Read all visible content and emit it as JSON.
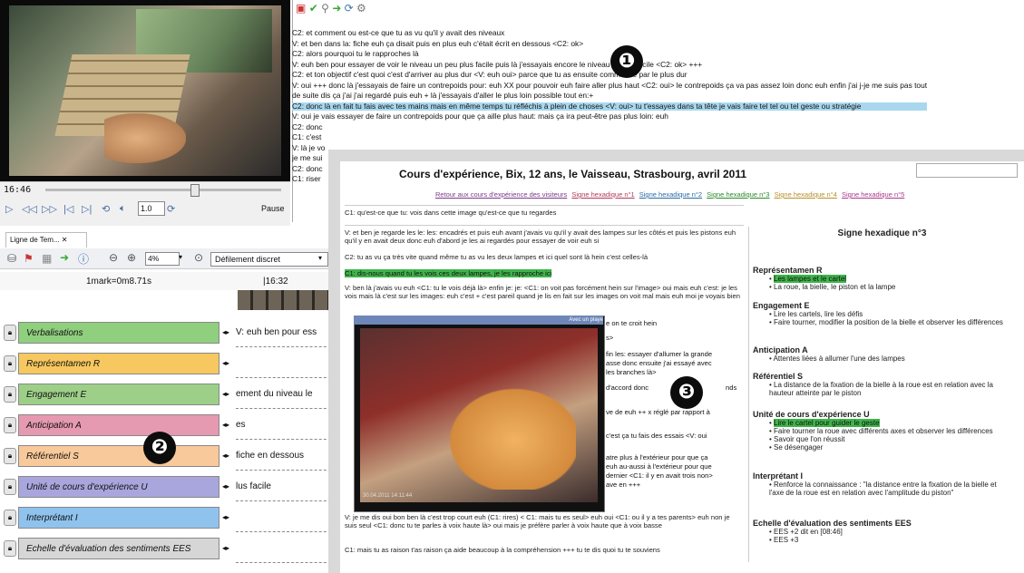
{
  "player": {
    "timecode": "16:46",
    "speed": "1.0",
    "pause_label": "Pause"
  },
  "transcript": {
    "lines": [
      "C2: et comment ou est-ce que tu as vu qu'il y avait des niveaux",
      "V: et ben dans la: fiche euh ça disait puis en plus euh c'était écrit en dessous <C2: ok>",
      "C2: alors pourquoi tu le rapproches là",
      "V: euh ben pour essayer de voir le niveau un peu plus facile puis là j'essayais encore le niveau le plus facile <C2: ok> +++",
      "C2: et ton objectif c'est quoi c'est d'arriver au plus dur <V: euh oui> parce que tu as ensuite commencé par le plus dur",
      "V: oui +++ donc là j'essayais de faire un contrepoids pour: euh XX pour pouvoir euh faire aller plus haut <C2: oui> le contrepoids ça va pas assez loin donc euh enfin j'ai j-je me suis pas tout",
      "de suite dis ça j'ai j'ai regardé puis euh + là j'essayais d'aller le plus loin possible tout en:+",
      "C2: donc là en fait tu fais avec tes mains mais en même temps tu réfléchis à plein de choses <V: oui> tu t'essayes dans ta tête je vais faire tel tel ou tel geste ou stratégie",
      "V: oui je vais essayer de faire un contrepoids pour que ça aille plus haut: mais ça ira peut-être pas plus loin: euh",
      "C2: donc",
      "C1: c'est",
      "V: là je vo",
      "je me sui",
      "C2: donc",
      "C1: riser"
    ]
  },
  "timeline": {
    "tab_label": "Ligne de Tem... ✕",
    "zoom": "4%",
    "scroll_mode": "Défilement discret",
    "mark_scale": "1mark=0m8.71s",
    "time_marker": "|16:32",
    "tracks": [
      {
        "label": "Verbalisations",
        "color": "#8fcf7e",
        "text": "V: euh ben pour ess"
      },
      {
        "label": "Représentamen R",
        "color": "#f6c85f",
        "text": ""
      },
      {
        "label": "Engagement E",
        "color": "#9dcf88",
        "text": "ement du niveau le"
      },
      {
        "label": "Anticipation A",
        "color": "#e59ab2",
        "text": "es"
      },
      {
        "label": "Référentiel S",
        "color": "#f8c99a",
        "text": "fiche en dessous"
      },
      {
        "label": "Unité de cours d'expérience U",
        "color": "#a9a6dd",
        "text": "lus facile"
      },
      {
        "label": "Interprétant I",
        "color": "#8fc3ee",
        "text": ""
      },
      {
        "label": "Echelle d'évaluation des sentiments EES",
        "color": "#d6d6d6",
        "text": ""
      }
    ]
  },
  "doc": {
    "title": "Cours d'expérience, Bix, 12 ans, le Vaisseau, Strasbourg, avril 2011",
    "links": [
      "Retour aux cours d'expérience des visiteurs",
      "Signe hexadique n°1",
      "Signe hexadique n°2",
      "Signe hexadique n°3",
      "Signe hexadique n°4",
      "Signe hexadique n°5"
    ],
    "q1": "C1: qu'est-ce que tu: vois dans cette image qu'est-ce que tu regardes",
    "p1": "V: et ben je regarde les le: les: encadrés et puis euh avant j'avais vu qu'il y avait des lampes sur les côtés et puis les pistons euh qu'il y en avait deux donc euh d'abord je les ai regardés pour essayer de voir euh si",
    "p2": "C2: tu as vu ça très vite quand même tu as vu les deux lampes et ici quel sont là hein c'est celles-là",
    "p3": "C1: dis-nous quand tu les vois ces deux lampes, je les rapproche ici",
    "p4": "V: ben là j'avais vu euh <C1: tu le vois déjà là> enfin je: je: <C1: on voit pas forcément hein sur l'image> oui mais euh c'est: je les vois mais là c'est sur les images: euh c'est + c'est pareil quand je lis en fait sur les images on voit mal mais euh moi je voyais bien",
    "frag": [
      "e on te croit hein",
      "s>",
      "fin les: essayer d'allumer la grande",
      "asse donc ensuite j'ai essayé avec",
      "les branches là>",
      "d'accord donc",
      "nds",
      "ve de euh ++ x réglé par rapport à",
      "c'est ça tu fais des essais <V: oui",
      "atre plus à l'extérieur pour que ça",
      "euh au-aussi à l'extérieur pour que",
      "dernier <C1: il y en avait trois non>",
      "ave en +++"
    ],
    "p5": "V: je me dis oui bon ben là c'est trop court euh (C1: rires) < C1: mais tu es seul> euh oui <C1: ou il y a tes parents> euh non je suis seul <C1: donc tu te parles à voix haute là> oui mais je préfère parler à voix haute que à voix basse",
    "p6": "C1: mais tu as raison t'as raison ça aide beaucoup à la compréhension +++ tu te dis quoi tu te souviens",
    "video_caption": "Avec un playe",
    "video_timestamp": "30.04.2011 14:11:44",
    "right": {
      "title": "Signe hexadique n°3",
      "sections": [
        {
          "head": "Représentamen R",
          "items": [
            "Les lampes et le cartel",
            "La roue, la bielle, le piston et la lampe"
          ]
        },
        {
          "head": "Engagement E",
          "items": [
            "Lire les cartels, lire les défis",
            "Faire tourner, modifier la position de la bielle et observer les différences"
          ]
        },
        {
          "head": "Anticipation A",
          "items": [
            "Attentes liées à allumer l'une des lampes"
          ]
        },
        {
          "head": "Référentiel S",
          "items": [
            "La distance de la fixation de la bielle à la roue est en relation avec la hauteur atteinte par le piston"
          ]
        },
        {
          "head": "Unité de cours d'expérience U",
          "items": [
            "Lire le cartel pour guider le geste",
            "Faire tourner la roue avec différents axes et observer les différences",
            "Savoir que l'on réussit",
            "Se désengager"
          ]
        },
        {
          "head": "Interprétant I",
          "items": [
            "Renforce la connaissance : \"la distance entre la fixation de la bielle et l'axe de la roue est en relation avec l'amplitude du piston\""
          ]
        },
        {
          "head": "Echelle d'évaluation des sentiments EES",
          "items": [
            "EES +2 dit en [08:46]",
            "EES +3"
          ]
        }
      ]
    }
  },
  "markers": [
    "❶",
    "❷",
    "❸"
  ]
}
